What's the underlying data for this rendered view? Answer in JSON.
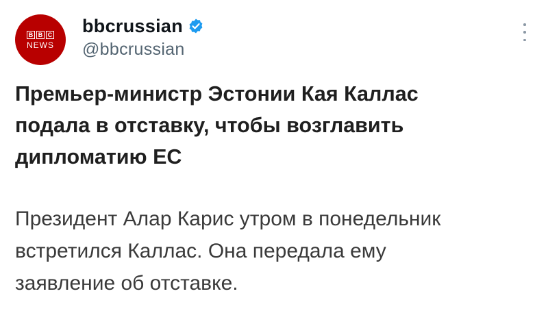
{
  "account": {
    "avatar": {
      "bbc_letters": [
        "B",
        "B",
        "C"
      ],
      "news_text": "NEWS",
      "color": "#b80000"
    },
    "display_name": "bbcrussian",
    "handle": "@bbcrussian",
    "verified_icon": "verified-badge-icon",
    "verified_color": "#1d9bf0"
  },
  "menu": {
    "icon": "more-vertical-icon"
  },
  "post": {
    "headline": "Премьер-министр Эстонии Кая Каллас\nподала в отставку, чтобы возглавить\nдипломатию ЕС",
    "body": "Президент Алар Карис утром в понедельник\nвстретился Каллас. Она передала ему\nзаявление об отставке."
  }
}
